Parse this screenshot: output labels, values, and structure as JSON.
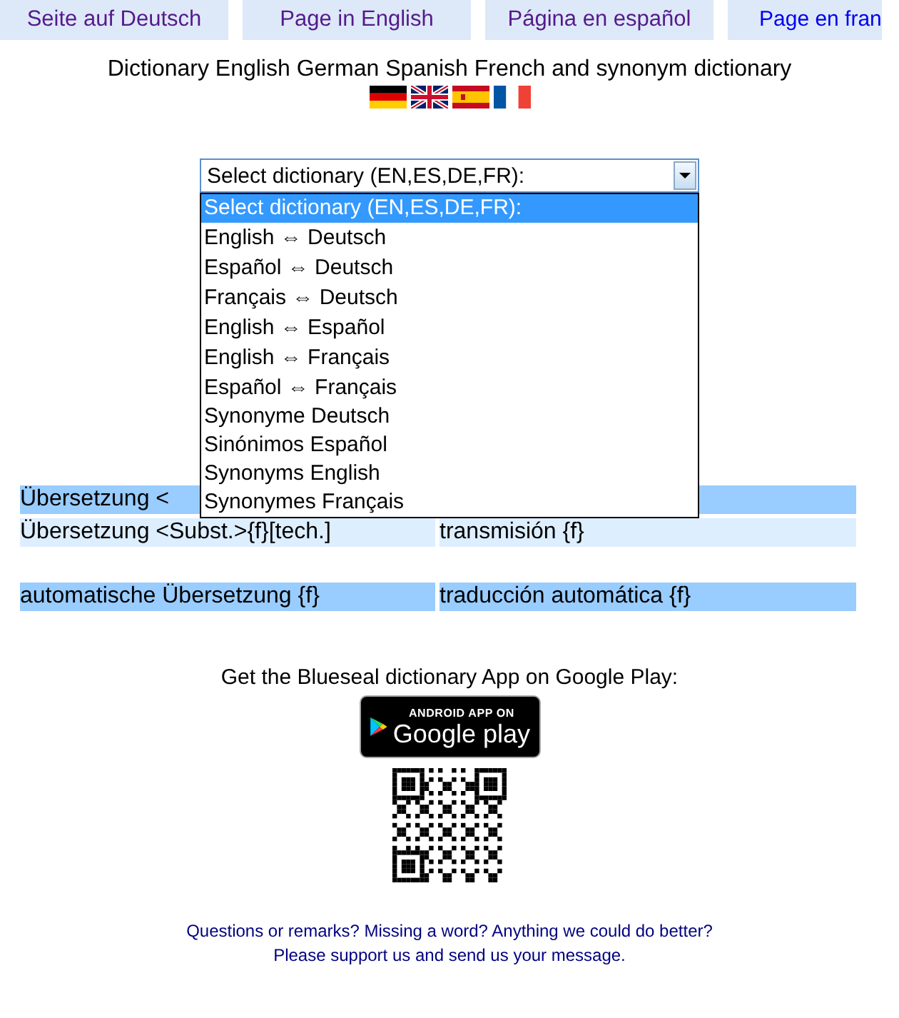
{
  "language_tabs": [
    {
      "label": "Seite auf Deutsch",
      "visited": true
    },
    {
      "label": "Page in English",
      "visited": true
    },
    {
      "label": "Página en español",
      "visited": true
    },
    {
      "label": "Page en fran",
      "visited": false
    }
  ],
  "title": "Dictionary English German Spanish French and synonym dictionary",
  "flags": [
    {
      "kind": "de"
    },
    {
      "kind": "uk"
    },
    {
      "kind": "es"
    },
    {
      "kind": "fr"
    }
  ],
  "dictionary_select": {
    "value": "Select dictionary (EN,ES,DE,FR):",
    "expanded": true,
    "options": [
      {
        "label": "Select dictionary (EN,ES,DE,FR):",
        "selected": true
      },
      {
        "label": "English ⇔ Deutsch",
        "selected": false
      },
      {
        "label": "Español ⇔ Deutsch",
        "selected": false
      },
      {
        "label": "Français ⇔ Deutsch",
        "selected": false
      },
      {
        "label": "English ⇔ Español",
        "selected": false
      },
      {
        "label": "English ⇔ Français",
        "selected": false
      },
      {
        "label": "Español ⇔ Français",
        "selected": false
      },
      {
        "label": "Synonyme Deutsch",
        "selected": false
      },
      {
        "label": "Sinónimos Español",
        "selected": false
      },
      {
        "label": "Synonyms English",
        "selected": false
      },
      {
        "label": "Synonymes Français",
        "selected": false
      }
    ]
  },
  "results": [
    {
      "kind": "main",
      "column_1": "Übersetzung <"
    },
    {
      "kind": "sub",
      "column_1": "Übersetzung <Subst.>{f}[tech.]",
      "column_2": "transmisión {f}"
    },
    {
      "kind": "gap"
    },
    {
      "kind": "main",
      "column_1": "automatische Übersetzung {f}",
      "column_2": "traducción automática {f}"
    }
  ],
  "app_promo": {
    "text": "Get the Blueseal dictionary App on Google Play:",
    "badge_top": "ANDROID APP ON",
    "badge_main": "Google play"
  },
  "feedback": [
    "Questions or remarks? Missing a word? Anything we could do better?",
    "Please support us and send us your message."
  ]
}
